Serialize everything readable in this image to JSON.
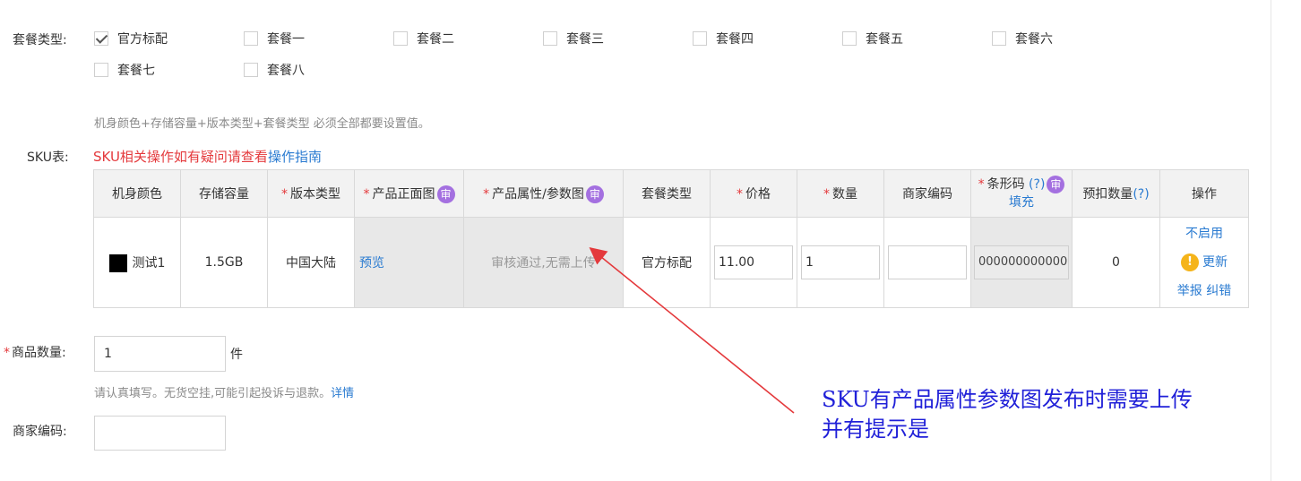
{
  "package": {
    "label": "套餐类型:",
    "options": [
      {
        "label": "官方标配",
        "checked": true
      },
      {
        "label": "套餐一",
        "checked": false
      },
      {
        "label": "套餐二",
        "checked": false
      },
      {
        "label": "套餐三",
        "checked": false
      },
      {
        "label": "套餐四",
        "checked": false
      },
      {
        "label": "套餐五",
        "checked": false
      },
      {
        "label": "套餐六",
        "checked": false
      },
      {
        "label": "套餐七",
        "checked": false
      },
      {
        "label": "套餐八",
        "checked": false
      }
    ],
    "hint": "机身颜色+存储容量+版本类型+套餐类型 必须全部都要设置值。"
  },
  "sku": {
    "label": "SKU表:",
    "notice": "SKU相关操作如有疑问请查看",
    "guide_link": "操作指南",
    "headers": {
      "color": "机身颜色",
      "storage": "存储容量",
      "version": "版本类型",
      "front_image": "产品正面图",
      "param_image": "产品属性/参数图",
      "package": "套餐类型",
      "price": "价格",
      "quantity": "数量",
      "merchant_code": "商家编码",
      "barcode": "条形码",
      "barcode_help": "(?)",
      "barcode_fill": "填充",
      "reserve_qty": "预扣数量",
      "reserve_help": "(?)",
      "ops": "操作",
      "review_badge": "审"
    },
    "row": {
      "color": "测试1",
      "color_swatch": "#000000",
      "storage": "1.5GB",
      "version": "中国大陆",
      "front_image": "预览",
      "param_image": "审核通过,无需上传",
      "package": "官方标配",
      "price": "11.00",
      "quantity": "1",
      "merchant_code": "",
      "barcode": "0000000000000",
      "reserve_qty": "0",
      "op_disable": "不启用",
      "op_update": "更新",
      "op_report": "举报",
      "op_correct": "纠错"
    }
  },
  "product_qty": {
    "label": "商品数量:",
    "value": "1",
    "unit": "件",
    "hint": "请认真填写。无货空挂,可能引起投诉与退款。",
    "detail_link": "详情"
  },
  "merchant_code": {
    "label": "商家编码:",
    "value": ""
  },
  "annotation": {
    "line1": "SKU有产品属性参数图发布时需要上传",
    "line2": "并有提示是",
    "color": "#2020d8",
    "arrow_color": "#e4393c"
  }
}
